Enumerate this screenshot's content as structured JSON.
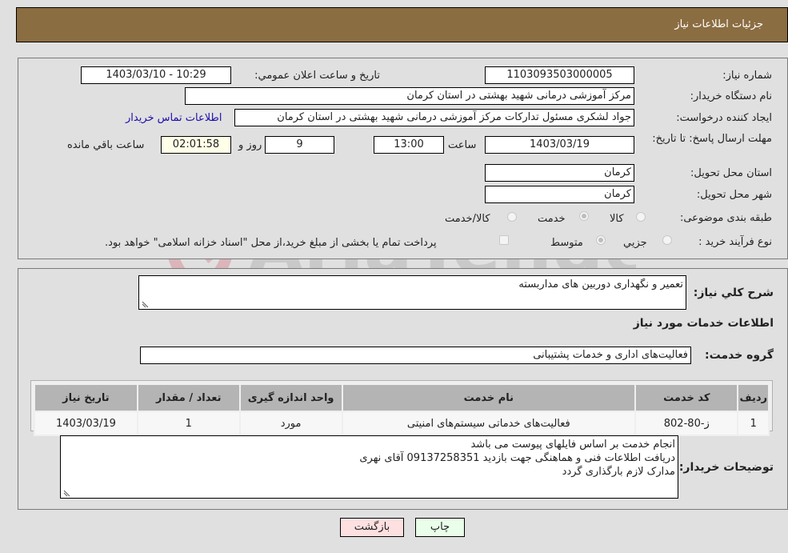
{
  "header": {
    "title": "جزئیات اطلاعات نیاز"
  },
  "fields": {
    "need_number": {
      "label": "شماره نیاز:",
      "value": "1103093503000005"
    },
    "announce_datetime": {
      "label": "تاریخ و ساعت اعلان عمومي:",
      "value": "1403/03/10 - 10:29"
    },
    "buyer_org": {
      "label": "نام دستگاه خريدار:",
      "value": "مرکز آموزشی درمانی شهید بهشتی در استان کرمان"
    },
    "requester": {
      "label": "ايجاد کننده درخواست:",
      "value": "جواد لشکری مسئول تدارکات مرکز آموزشی درمانی شهید بهشتی در استان کرمان",
      "contact_link": "اطلاعات تماس خريدار"
    },
    "deadline": {
      "label": "مهلت ارسال پاسخ: تا تاريخ:",
      "date": "1403/03/19",
      "time_label": "ساعت",
      "time": "13:00",
      "days": "9",
      "days_label": "روز و",
      "remaining": "02:01:58",
      "remaining_label": "ساعت باقي مانده"
    },
    "delivery_province": {
      "label": "استان محل تحويل:",
      "value": "کرمان"
    },
    "delivery_city": {
      "label": "شهر محل تحويل:",
      "value": "کرمان"
    },
    "category": {
      "label": "طبقه بندی موضوعی:",
      "options": [
        "کالا",
        "خدمت",
        "کالا/خدمت"
      ],
      "selected": "خدمت"
    },
    "purchase_type": {
      "label": "نوع فرآيند خريد :",
      "options": [
        "جزيي",
        "متوسط"
      ],
      "selected": "متوسط",
      "treasury_checkbox_label": "پرداخت تمام يا بخشی از مبلغ خريد،از محل \"اسناد خزانه اسلامی\" خواهد بود.",
      "treasury_checked": false
    }
  },
  "description": {
    "label": "شرح کلي نياز:",
    "value": "تعمیر و نگهداری دوربین های مداربسته"
  },
  "services_section": {
    "title": "اطلاعات خدمات مورد نياز"
  },
  "service_group": {
    "label": "گروه خدمت:",
    "value": "فعالیت‌های اداری و خدمات پشتیبانی"
  },
  "table": {
    "columns": [
      "رديف",
      "کد خدمت",
      "نام خدمت",
      "واحد اندازه گيری",
      "تعداد / مقدار",
      "تاريخ نياز"
    ],
    "rows": [
      [
        "1",
        "ز-80-802",
        "فعالیت‌های خدماتی سیستم‌های امنیتی",
        "مورد",
        "1",
        "1403/03/19"
      ]
    ]
  },
  "buyer_notes": {
    "label": "توضيحات خريدار:",
    "lines": [
      "انجام خدمت بر اساس فایلهای پیوست می باشد",
      "دریافت اطلاعات فنی  و هماهنگی جهت بازدید 09137258351 آقای نهری",
      "مدارک لازم بارگذاری گردد"
    ]
  },
  "buttons": {
    "print": "چاپ",
    "back": "بازگشت"
  },
  "watermark": {
    "text": "AriaTender.neT"
  },
  "colors": {
    "header_bg": "#8b6d42",
    "print_bg": "#eaffea",
    "back_bg": "#ffe0e0",
    "link": "#1a0dab"
  }
}
